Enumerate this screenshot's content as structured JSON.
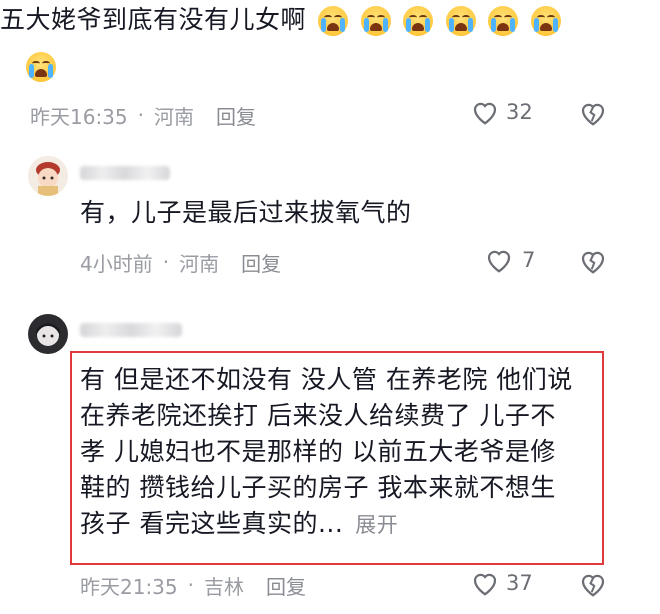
{
  "comments": [
    {
      "text": "五大姥爷到底有没有儿女啊",
      "time": "昨天16:35",
      "location": "河南",
      "reply_label": "回复",
      "likes": "32"
    },
    {
      "text": "有，儿子是最后过来拔氧气的",
      "time": "4小时前",
      "location": "河南",
      "reply_label": "回复",
      "likes": "7"
    },
    {
      "lines": [
        "有 但是还不如没有 没人管 在养老院 他们说",
        "在养老院还挨打 后来没人给续费了 儿子不",
        "孝 儿媳妇也不是那样的 以前五大老爷是修",
        "鞋的 攒钱给儿子买的房子  我本来就不想生",
        "孩子 看完这些真实的..."
      ],
      "expand_label": "展开",
      "time": "昨天21:35",
      "location": "吉林",
      "reply_label": "回复",
      "likes": "37"
    }
  ],
  "separator": "·",
  "colors": {
    "highlight_border": "#e23a3a",
    "meta": "#9a9ca3",
    "text": "#161823"
  }
}
